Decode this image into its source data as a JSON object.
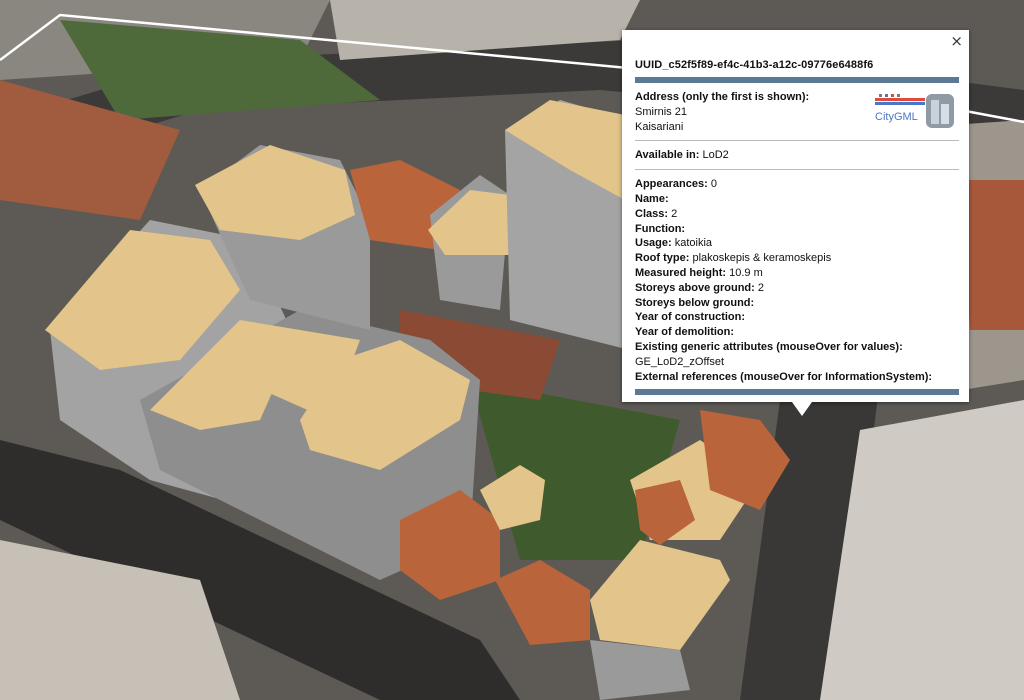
{
  "popup": {
    "close_glyph": "×",
    "uuid": "UUID_c52f5f89-ef4c-41b3-a12c-09776e6488f6",
    "address_label": "Address (only the first is shown):",
    "address_line1": "Smirnis 21",
    "address_line2": "Kaisariani",
    "logo_text": "CityGML",
    "available_label": "Available in:",
    "available_value": "LoD2",
    "attributes": [
      {
        "label": "Appearances:",
        "value": "0"
      },
      {
        "label": "Name:",
        "value": ""
      },
      {
        "label": "Class:",
        "value": "2"
      },
      {
        "label": "Function:",
        "value": ""
      },
      {
        "label": "Usage:",
        "value": "katoikia"
      },
      {
        "label": "Roof type:",
        "value": "plakoskepis & keramoskepis"
      },
      {
        "label": "Measured height:",
        "value": "10.9 m"
      },
      {
        "label": "Storeys above ground:",
        "value": "2"
      },
      {
        "label": "Storeys below ground:",
        "value": ""
      },
      {
        "label": "Year of construction:",
        "value": ""
      },
      {
        "label": "Year of demolition:",
        "value": ""
      }
    ],
    "generic_label": "Existing generic attributes (mouseOver for values):",
    "generic_value": "GE_LoD2_zOffset",
    "external_label": "External references (mouseOver for InformationSystem):"
  },
  "colors": {
    "roof_flat": "#e3c48a",
    "roof_tile": "#b8623a",
    "wall": "#9e9e9e",
    "header_bar": "#5c7a95"
  }
}
